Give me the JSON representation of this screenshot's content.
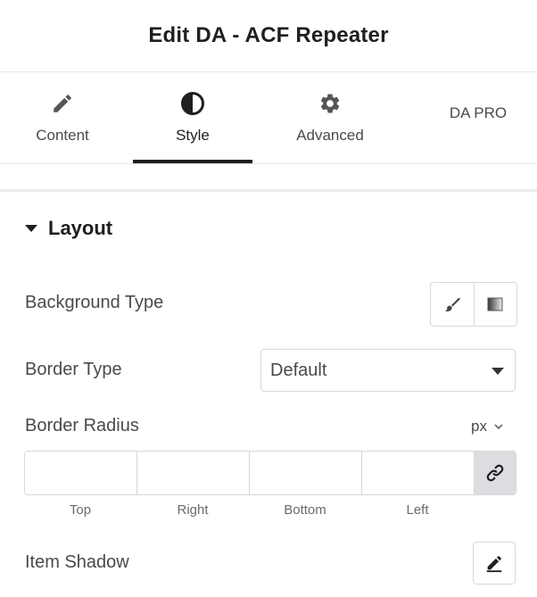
{
  "header": {
    "title": "Edit DA - ACF Repeater"
  },
  "tabs": [
    {
      "label": "Content",
      "icon": "pencil-icon",
      "active": false
    },
    {
      "label": "Style",
      "icon": "half-circle-icon",
      "active": true
    },
    {
      "label": "Advanced",
      "icon": "gear-icon",
      "active": false
    },
    {
      "label": "DA PRO",
      "icon": "",
      "active": false
    }
  ],
  "section": {
    "title": "Layout",
    "expanded": true
  },
  "background_type": {
    "label": "Background Type",
    "options": [
      "brush-icon",
      "gradient-icon"
    ]
  },
  "border_type": {
    "label": "Border Type",
    "value": "Default"
  },
  "border_radius": {
    "label": "Border Radius",
    "unit": "px",
    "fields": {
      "top": "Top",
      "right": "Right",
      "bottom": "Bottom",
      "left": "Left"
    }
  },
  "item_shadow": {
    "label": "Item Shadow"
  },
  "colors": {
    "text": "#4a4a4a",
    "heading": "#1f1f1f",
    "border": "#d8d8d8",
    "link_bg": "#dcdde0"
  }
}
